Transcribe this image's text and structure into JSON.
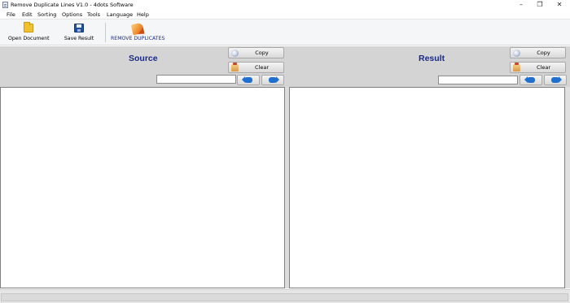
{
  "window": {
    "title": "Remove Duplicate Lines V1.0 - 4dots Software",
    "min_glyph": "–",
    "max_glyph": "❐",
    "close_glyph": "✕"
  },
  "menu": [
    "File",
    "Edit",
    "Sorting",
    "Options",
    "Tools",
    "Language",
    "Help"
  ],
  "toolbar": {
    "open_label": "Open Document",
    "save_label": "Save Result",
    "remove_label": "REMOVE DUPLICATES"
  },
  "source": {
    "title": "Source",
    "copy_label": "Copy",
    "clear_label": "Clear",
    "search_value": "",
    "text": ""
  },
  "result": {
    "title": "Result",
    "copy_label": "Copy",
    "clear_label": "Clear",
    "search_value": "",
    "text": ""
  },
  "icons": {
    "open": "folder-icon",
    "save": "floppy-disk-icon",
    "remove": "remove-duplicates-icon",
    "copy": "copy-icon",
    "clear": "clear-icon",
    "prev": "arrow-left-icon",
    "next": "arrow-right-icon"
  },
  "colors": {
    "pane_title": "#1a2a8a",
    "header_bg": "#d4d4d4",
    "arrow_blue": "#1f6fd0"
  }
}
